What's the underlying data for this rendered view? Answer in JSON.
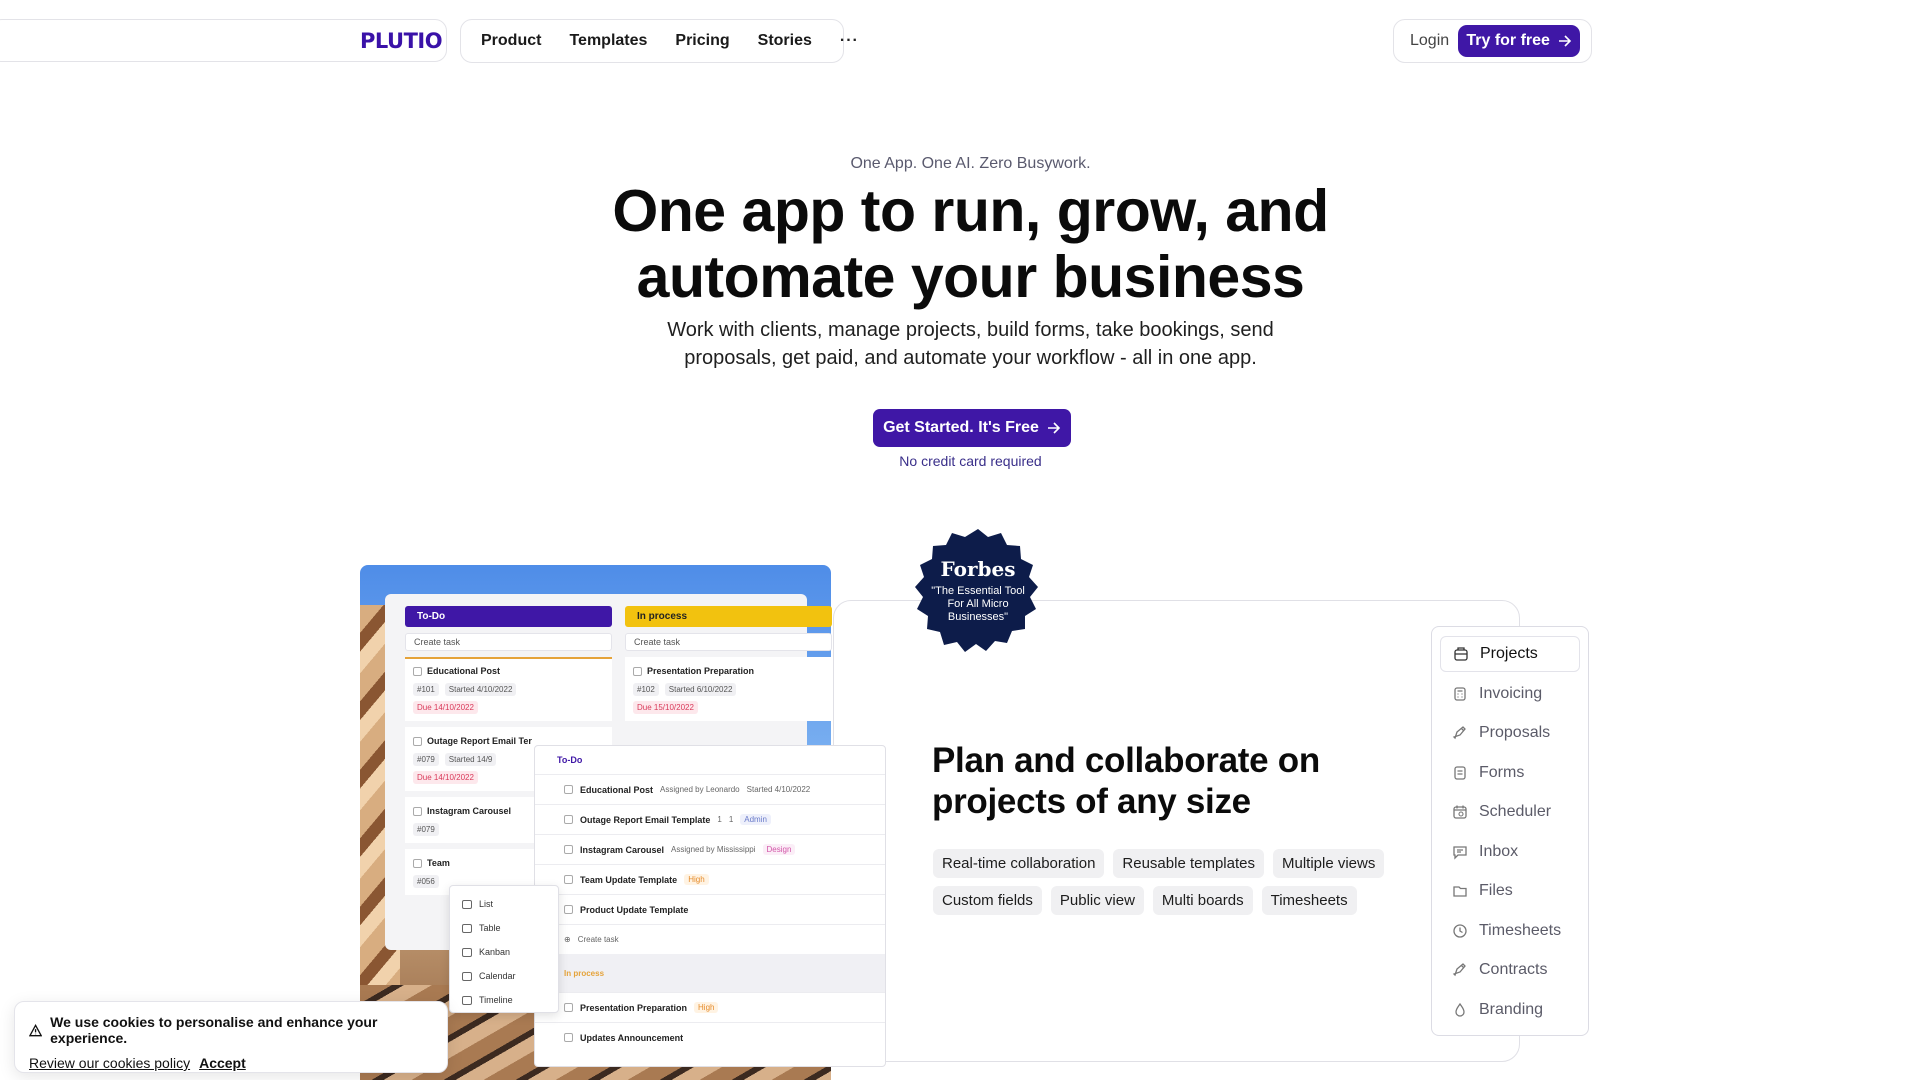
{
  "nav": {
    "logo": "PLUTIO",
    "links": [
      "Product",
      "Templates",
      "Pricing",
      "Stories"
    ],
    "more": "···",
    "login": "Login",
    "try": "Try for free"
  },
  "hero": {
    "eyebrow": "One App. One AI. Zero Busywork.",
    "headline_line1": "One app to run, grow, and",
    "headline_line2": "automate your business",
    "sub_line1": "Work with clients, manage projects, build forms, take bookings, send",
    "sub_line2": "proposals, get paid, and automate your workflow - all in one app.",
    "cta": "Get Started. It's Free",
    "note": "No credit card required"
  },
  "forbes": {
    "name": "Forbes",
    "quote": "\"The Essential Tool For All Micro Businesses\""
  },
  "feature": {
    "title_line1": "Plan and collaborate on",
    "title_line2": "projects of any size",
    "tags": [
      "Real-time collaboration",
      "Reusable templates",
      "Multiple views",
      "Custom fields",
      "Public view",
      "Multi boards",
      "Timesheets"
    ]
  },
  "side_menu": {
    "items": [
      "Projects",
      "Invoicing",
      "Proposals",
      "Forms",
      "Scheduler",
      "Inbox",
      "Files",
      "Timesheets",
      "Contracts",
      "Branding"
    ],
    "active": "Projects"
  },
  "mock": {
    "todo": {
      "label": "To-Do",
      "create": "Create task",
      "tasks": [
        {
          "title": "Educational Post",
          "id": "#101",
          "started": "Started 4/10/2022",
          "due": "Due 14/10/2022"
        },
        {
          "title": "Outage Report Email Ter",
          "id": "#079",
          "started": "Started 14/9",
          "due": "Due 14/10/2022"
        },
        {
          "title": "Instagram Carousel",
          "id": "#079"
        },
        {
          "title": "Team",
          "id": "#056"
        }
      ]
    },
    "inprocess": {
      "label": "In process",
      "create": "Create task",
      "tasks": [
        {
          "title": "Presentation Preparation",
          "id": "#102",
          "started": "Started 6/10/2022",
          "due": "Due 15/10/2022"
        }
      ]
    },
    "list": {
      "head": "To-Do",
      "rows": [
        {
          "title": "Educational Post",
          "meta": "Assigned by Leonardo",
          "extra": "Started 4/10/2022"
        },
        {
          "title": "Outage Report Email Template",
          "meta": "1",
          "meta2": "1",
          "badge": "Admin"
        },
        {
          "title": "Instagram Carousel",
          "meta": "Assigned by Mississippi",
          "badge": "Design"
        },
        {
          "title": "Team Update Template",
          "badge": "High"
        },
        {
          "title": "Product Update Template"
        }
      ],
      "create": "Create task",
      "section": "In process",
      "rows2": [
        {
          "title": "Presentation Preparation",
          "badge": "High"
        },
        {
          "title": "Updates Announcement"
        }
      ]
    },
    "views": [
      "List",
      "Table",
      "Kanban",
      "Calendar",
      "Timeline"
    ]
  },
  "cookie": {
    "message": "We use cookies to personalise and enhance your experience.",
    "policy": "Review our cookies policy",
    "accept": "Accept"
  },
  "colors": {
    "brand": "#3f17a6",
    "todo_head": "#3f17a6",
    "inprocess_head": "#f2c20f"
  }
}
